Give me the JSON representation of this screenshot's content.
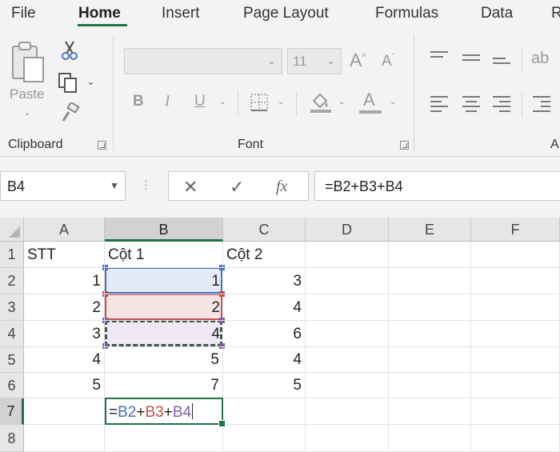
{
  "ribbon_tabs": [
    "File",
    "Home",
    "Insert",
    "Page Layout",
    "Formulas",
    "Data",
    "R"
  ],
  "clipboard": {
    "paste_label": "Paste",
    "group_label": "Clipboard"
  },
  "font": {
    "group_label": "Font",
    "font_size": "11",
    "bold": "B",
    "italic": "I",
    "underline": "U",
    "font_color_letter": "A",
    "grow_font": "A",
    "shrink_font": "A"
  },
  "alignment": {
    "group_label_partial": "A"
  },
  "formula_bar": {
    "name_box": "B4",
    "cancel": "✕",
    "enter": "✓",
    "function": "fx",
    "formula": "=B2+B3+B4"
  },
  "sheet": {
    "columns": [
      "A",
      "B",
      "C",
      "D",
      "E",
      "F"
    ],
    "rows": [
      "1",
      "2",
      "3",
      "4",
      "5",
      "6",
      "7",
      "8"
    ],
    "headers": {
      "A1": "STT",
      "B1": "Cột 1",
      "C1": "Cột 2"
    },
    "colA": [
      "1",
      "2",
      "3",
      "4",
      "5"
    ],
    "colB": [
      "1",
      "2",
      "4",
      "5",
      "7"
    ],
    "colC": [
      "3",
      "4",
      "6",
      "4",
      "5"
    ],
    "editing": {
      "cell": "B7",
      "eq": "=",
      "ref1": "B2",
      "plus1": "+",
      "ref2": "B3",
      "plus2": "+",
      "ref3": "B4"
    }
  },
  "colors": {
    "accent": "#217346",
    "ref1": "#4472c4",
    "ref2": "#c0504d",
    "ref3": "#7f5ea8"
  }
}
